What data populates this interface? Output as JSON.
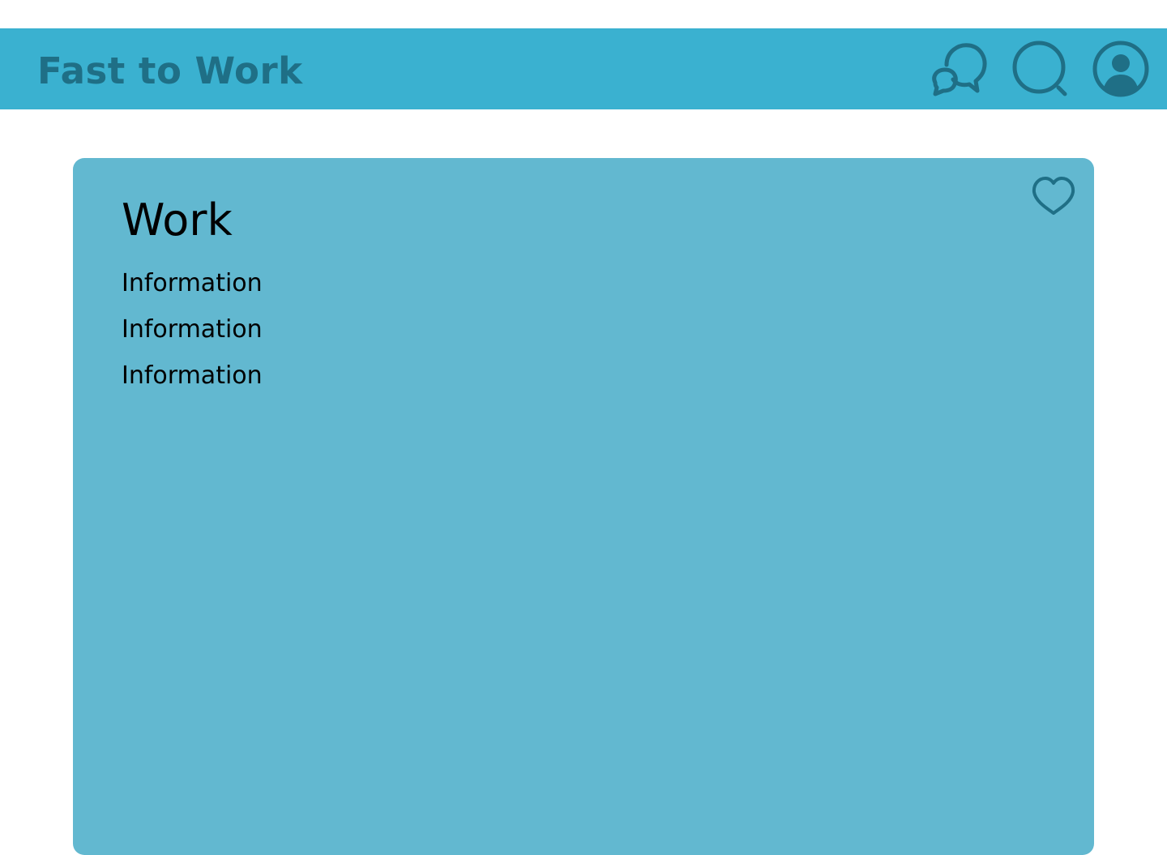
{
  "header": {
    "brand": "Fast to Work",
    "background": "#3AB1D0",
    "accent": "#1F6F86",
    "icons": [
      "chat-icon",
      "search-icon",
      "user-account-icon"
    ]
  },
  "card": {
    "background": "#62B8D0",
    "title": "Work",
    "info": [
      "Information",
      "Information",
      "Information"
    ],
    "favorite_icon": "heart-icon"
  }
}
